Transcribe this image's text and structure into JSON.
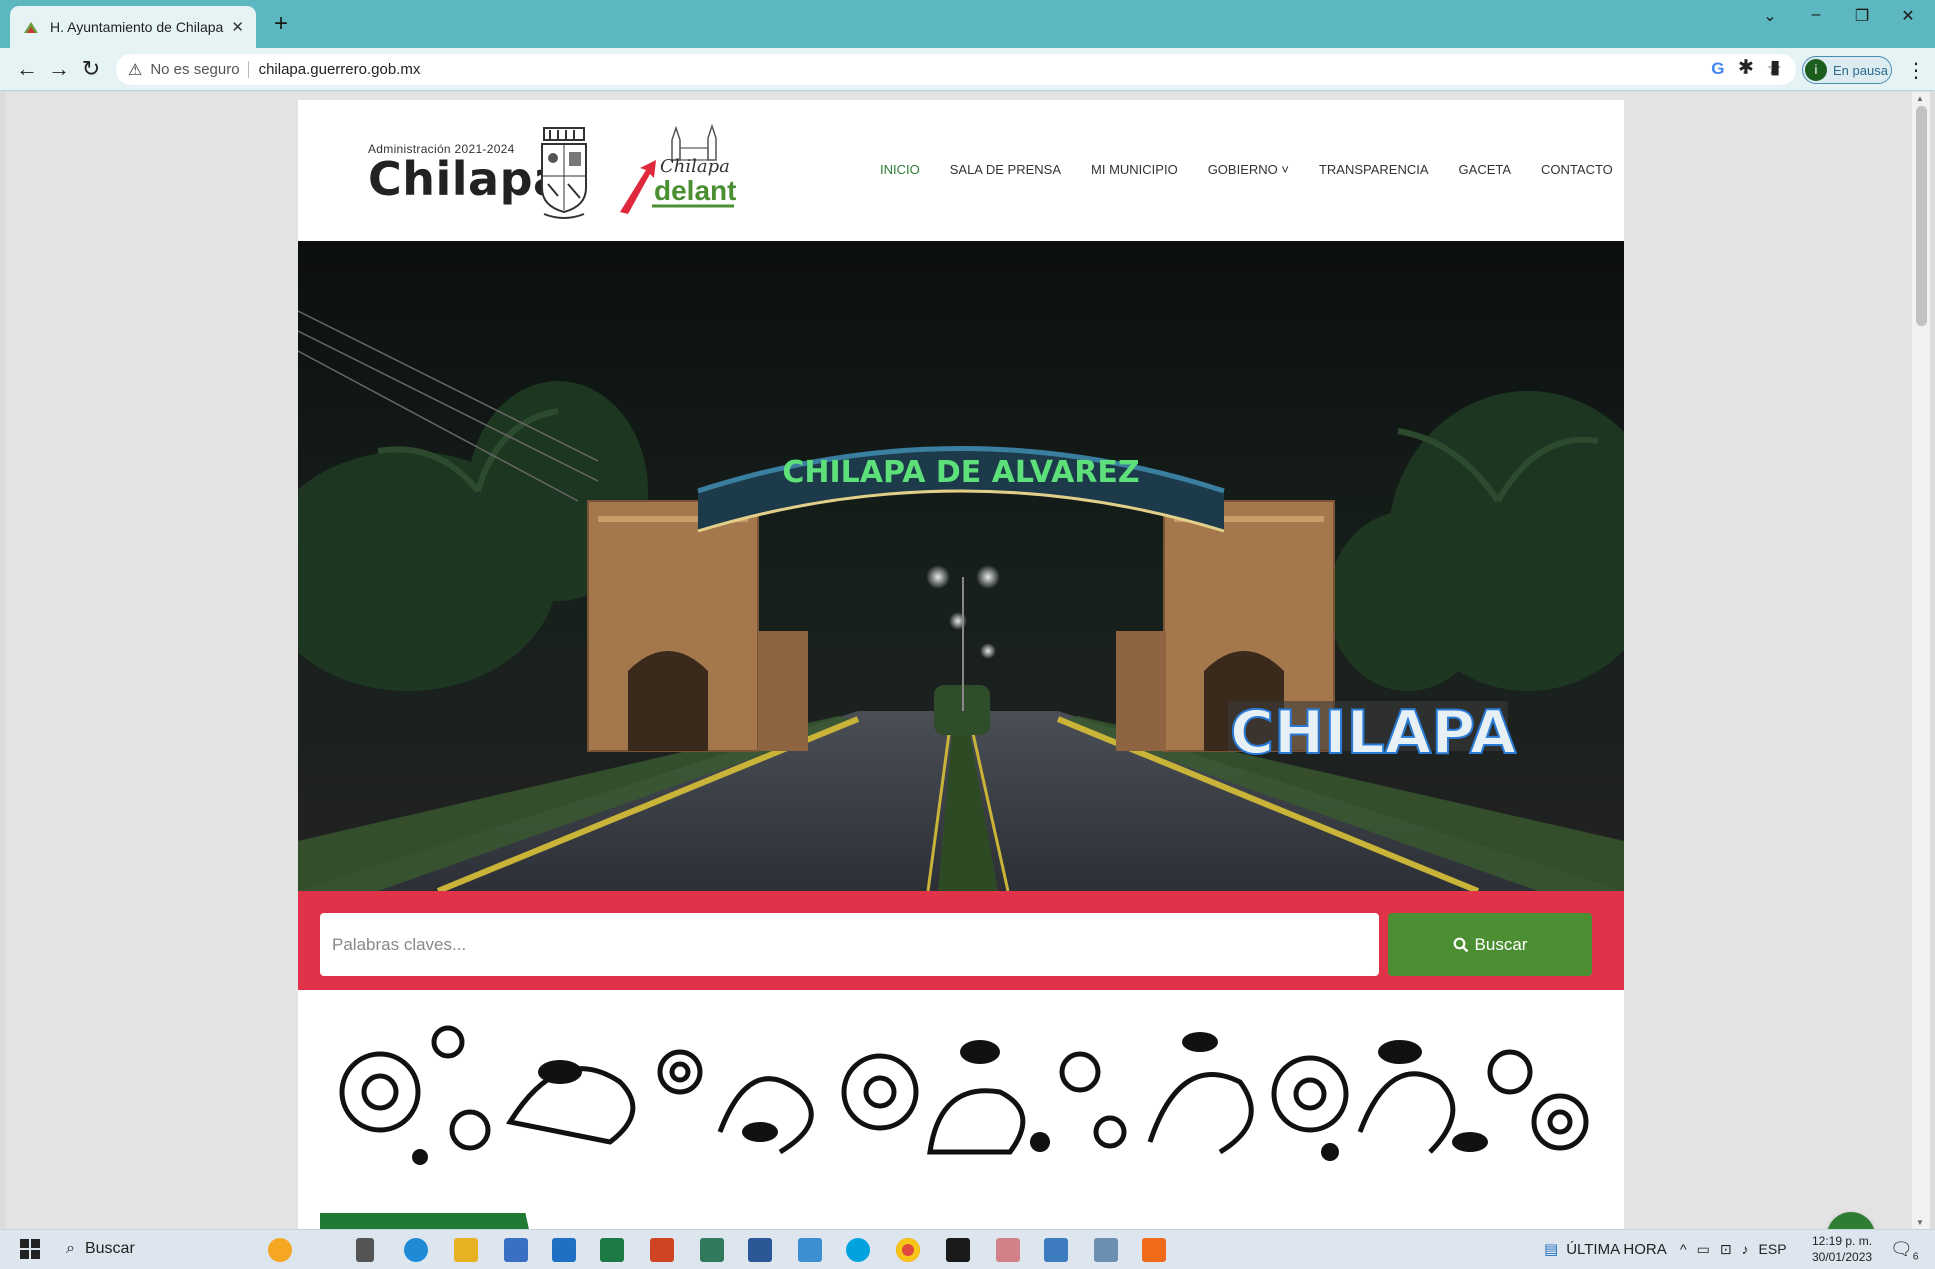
{
  "browser": {
    "tab_title": "H. Ayuntamiento de Chilapa de Á",
    "new_tab": "+",
    "security_label": "No es seguro",
    "url": "chilapa.guerrero.gob.mx",
    "profile_status": "En pausa",
    "profile_initial": "i"
  },
  "site": {
    "logo_admin_text": "Administración 2021-2024",
    "logo_name": "Chilapa",
    "logo2_line1": "Chilapa",
    "logo2_line2": "delante",
    "nav": [
      {
        "label": "INICIO",
        "active": true
      },
      {
        "label": "SALA DE PRENSA"
      },
      {
        "label": "MI MUNICIPIO"
      },
      {
        "label": "GOBIERNO ˅"
      },
      {
        "label": "TRANSPARENCIA"
      },
      {
        "label": "GACETA"
      },
      {
        "label": "CONTACTO"
      }
    ],
    "hero_arch_text": "CHILAPA DE ALVAREZ",
    "hero_sign_text": "CHILAPA",
    "search_placeholder": "Palabras claves...",
    "search_button": "Buscar"
  },
  "taskbar": {
    "search_label": "Buscar",
    "news_label": "ÚLTIMA HORA",
    "language": "ESP",
    "time": "12:19 p. m.",
    "date": "30/01/2023",
    "notifications": "6"
  },
  "colors": {
    "accent_green": "#2e7d32",
    "search_band": "#e0334a",
    "search_button": "#4b8f32",
    "tab_strip": "#5cb7c0"
  }
}
